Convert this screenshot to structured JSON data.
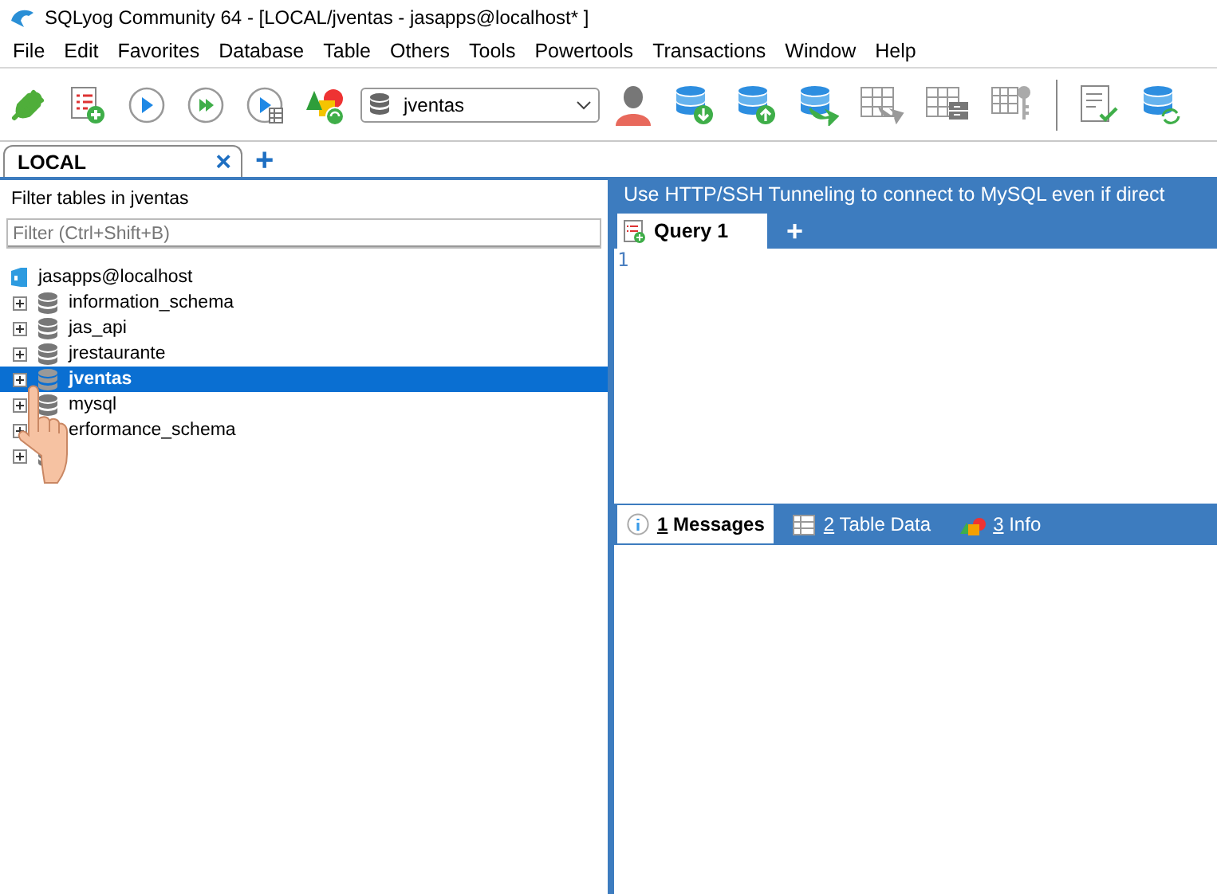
{
  "window": {
    "title": "SQLyog Community 64 - [LOCAL/jventas - jasapps@localhost* ]"
  },
  "menu": [
    "File",
    "Edit",
    "Favorites",
    "Database",
    "Table",
    "Others",
    "Tools",
    "Powertools",
    "Transactions",
    "Window",
    "Help"
  ],
  "toolbar": {
    "database_select": {
      "value": "jventas"
    }
  },
  "connection_tabs": [
    {
      "label": "LOCAL",
      "selected": true,
      "close": "×"
    }
  ],
  "add_tab": "+",
  "object_browser": {
    "filter_label": "Filter tables in jventas",
    "filter": {
      "placeholder": "Filter (Ctrl+Shift+B)"
    },
    "connection": "jasapps@localhost",
    "databases": [
      {
        "label": "information_schema",
        "expanded": false,
        "selected": false
      },
      {
        "label": "jas_api",
        "expanded": false,
        "selected": false
      },
      {
        "label": "jrestaurante",
        "expanded": false,
        "selected": false
      },
      {
        "label": "jventas",
        "expanded": false,
        "selected": true
      },
      {
        "label": "mysql",
        "expanded": false,
        "selected": false
      },
      {
        "label": "erformance_schema",
        "expanded": false,
        "selected": false
      },
      {
        "expanded": false,
        "selected": false
      }
    ]
  },
  "query_area": {
    "banner": "Use HTTP/SSH Tunneling to connect to MySQL even if direct",
    "tabs": [
      {
        "label": "Query 1",
        "selected": true
      }
    ],
    "add_tab": "+",
    "editor": {
      "line_numbers": [
        "1"
      ]
    },
    "result_tabs": [
      {
        "key": "1",
        "label": "Messages",
        "kind": "messages",
        "selected": true
      },
      {
        "key": "2",
        "label": "Table Data",
        "kind": "table",
        "selected": false
      },
      {
        "key": "3",
        "label": "Info",
        "kind": "info",
        "selected": false
      }
    ]
  }
}
